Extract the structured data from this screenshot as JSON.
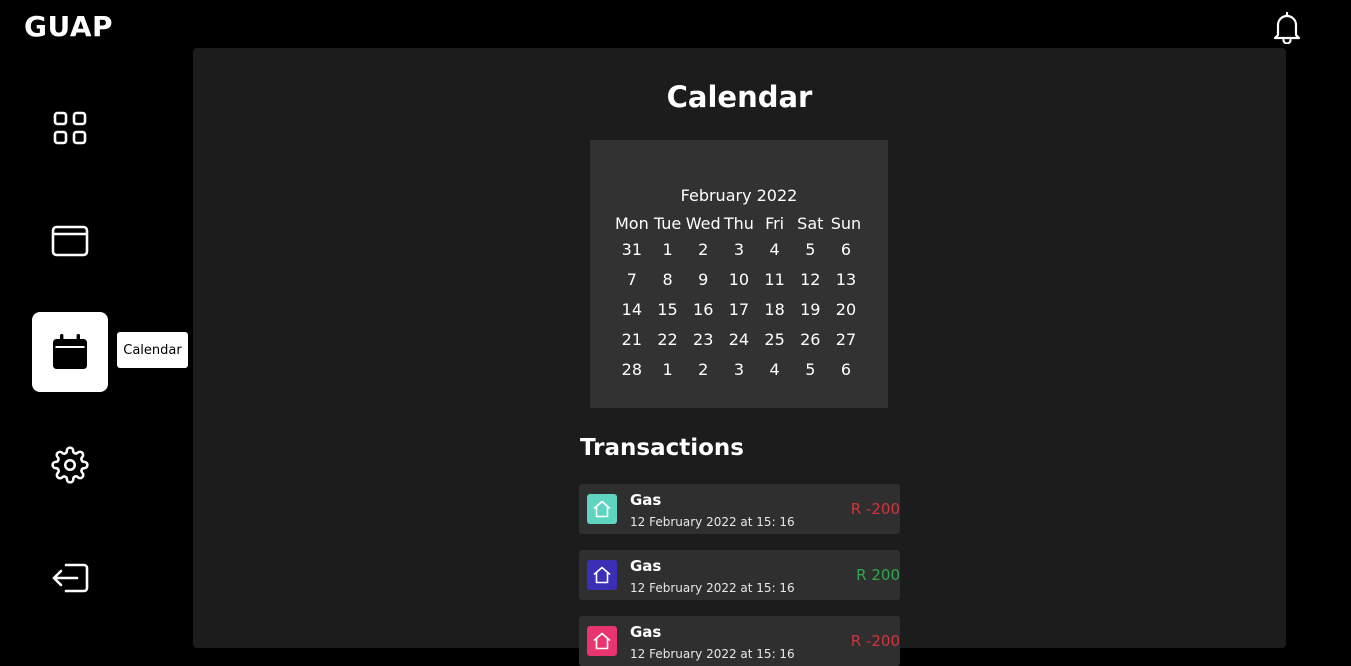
{
  "app": {
    "title": "GUAP"
  },
  "sidebar": {
    "items": [
      {
        "name": "dashboard",
        "icon": "grid-icon"
      },
      {
        "name": "wallet",
        "icon": "card-icon"
      },
      {
        "name": "calendar",
        "icon": "calendar-icon",
        "active": true
      },
      {
        "name": "settings",
        "icon": "gear-icon"
      },
      {
        "name": "logout",
        "icon": "logout-icon"
      }
    ],
    "tooltip": "Calendar"
  },
  "main": {
    "title": "Calendar",
    "calendar": {
      "month_label": "February 2022",
      "weekdays": [
        "Mon",
        "Tue",
        "Wed",
        "Thu",
        "Fri",
        "Sat",
        "Sun"
      ],
      "weeks": [
        [
          "31",
          "1",
          "2",
          "3",
          "4",
          "5",
          "6"
        ],
        [
          "7",
          "8",
          "9",
          "10",
          "11",
          "12",
          "13"
        ],
        [
          "14",
          "15",
          "16",
          "17",
          "18",
          "19",
          "20"
        ],
        [
          "21",
          "22",
          "23",
          "24",
          "25",
          "26",
          "27"
        ],
        [
          "28",
          "1",
          "2",
          "3",
          "4",
          "5",
          "6"
        ]
      ]
    },
    "transactions_heading": "Transactions",
    "transactions": [
      {
        "name": "Gas",
        "date": "12 February 2022 at 15: 16",
        "amount": "R -200",
        "amount_color": "#d3343f",
        "icon": "home-icon",
        "icon_bg": "#5fd4c0"
      },
      {
        "name": "Gas",
        "date": "12 February 2022 at 15: 16",
        "amount": "R 200",
        "amount_color": "#2fa84f",
        "icon": "home-icon",
        "icon_bg": "#3a2fb5"
      },
      {
        "name": "Gas",
        "date": "12 February 2022 at 15: 16",
        "amount": "R -200",
        "amount_color": "#d3343f",
        "icon": "home-icon",
        "icon_bg": "#e8356f"
      }
    ]
  },
  "colors": {
    "background": "#000000",
    "panel": "#1c1c1c",
    "calendar_bg": "#323232",
    "card_bg": "#2f2f2f"
  }
}
